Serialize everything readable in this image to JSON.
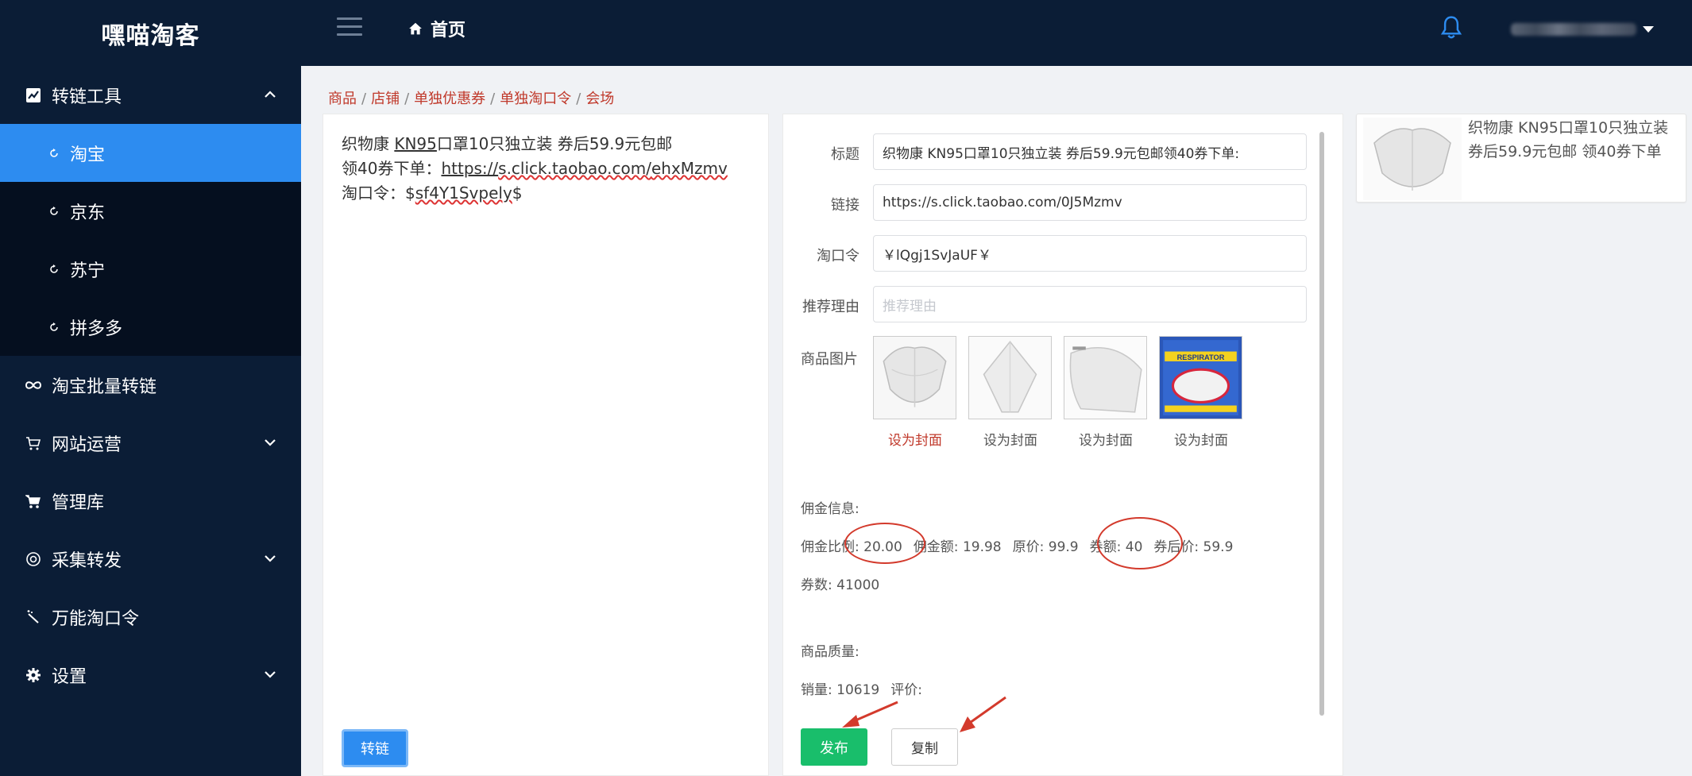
{
  "app": {
    "brand": "嘿喵淘客"
  },
  "header": {
    "home_label": "首页",
    "icons": [
      "menu-icon",
      "home-icon",
      "bell-icon",
      "caret-down-icon"
    ],
    "accent_color": "#0b1d36"
  },
  "sidebar": {
    "items": [
      {
        "label": "转链工具",
        "icon": "chart-icon",
        "expanded": true
      },
      {
        "label": "淘宝",
        "icon": "refresh-icon",
        "active": true
      },
      {
        "label": "京东",
        "icon": "refresh-icon"
      },
      {
        "label": "苏宁",
        "icon": "refresh-icon"
      },
      {
        "label": "拼多多",
        "icon": "refresh-icon"
      },
      {
        "label": "淘宝批量转链",
        "icon": "infinity-icon"
      },
      {
        "label": "网站运营",
        "icon": "cart-outline-icon",
        "expandable": true
      },
      {
        "label": "管理库",
        "icon": "cart-icon"
      },
      {
        "label": "采集转发",
        "icon": "target-icon",
        "expandable": true
      },
      {
        "label": "万能淘口令",
        "icon": "magic-wand-icon"
      },
      {
        "label": "设置",
        "icon": "gear-icon",
        "expandable": true
      }
    ],
    "active_color": "#2d8cf0"
  },
  "breadcrumb": [
    "商品",
    "店铺",
    "单独优惠券",
    "单独淘口令",
    "会场"
  ],
  "source": {
    "line1_prefix": "织物康 ",
    "line1_kn": "KN95",
    "line1_suffix": "口罩10只独立装 券后59.9元包邮",
    "line2_prefix": "领40券下单：",
    "line2_link_a": "https://",
    "line2_link_b": "s.click.taobao.com/",
    "line2_link_c": "ehxMzmv",
    "line3_prefix": "淘口令：$",
    "line3_code": "sf4Y1Svpely",
    "line3_suffix": "$",
    "convert_button": "转链"
  },
  "form": {
    "title_label": "标题",
    "title_value": "织物康 KN95口罩10只独立装 券后59.9元包邮领40券下单:",
    "link_label": "链接",
    "link_value": "https://s.click.taobao.com/0J5Mzmv",
    "code_label": "淘口令",
    "code_value": "￥lQgj1SvJaUF￥",
    "reason_label": "推荐理由",
    "reason_placeholder": "推荐理由",
    "images_label": "商品图片",
    "set_cover": "设为封面",
    "respirator_text": "RESPIRATOR"
  },
  "commission": {
    "heading": "佣金信息:",
    "rate_label": "佣金比例:",
    "rate_value": "20.00",
    "amount_label": "佣金额:",
    "amount_value": "19.98",
    "price_label": "原价:",
    "price_value": "99.9",
    "coupon_label": "券额:",
    "coupon_value": "40",
    "after_label": "券后价:",
    "after_value": "59.9",
    "count_label": "券数:",
    "count_value": "41000"
  },
  "quality": {
    "heading": "商品质量:",
    "sales_label": "销量:",
    "sales_value": "10619",
    "rating_label": "评价:",
    "rating_value": ""
  },
  "actions": {
    "publish": "发布",
    "copy": "复制",
    "publish_color": "#19be6b"
  },
  "preview": {
    "title": "织物康 KN95口罩10只独立装 券后59.9元包邮 领40券下单"
  }
}
